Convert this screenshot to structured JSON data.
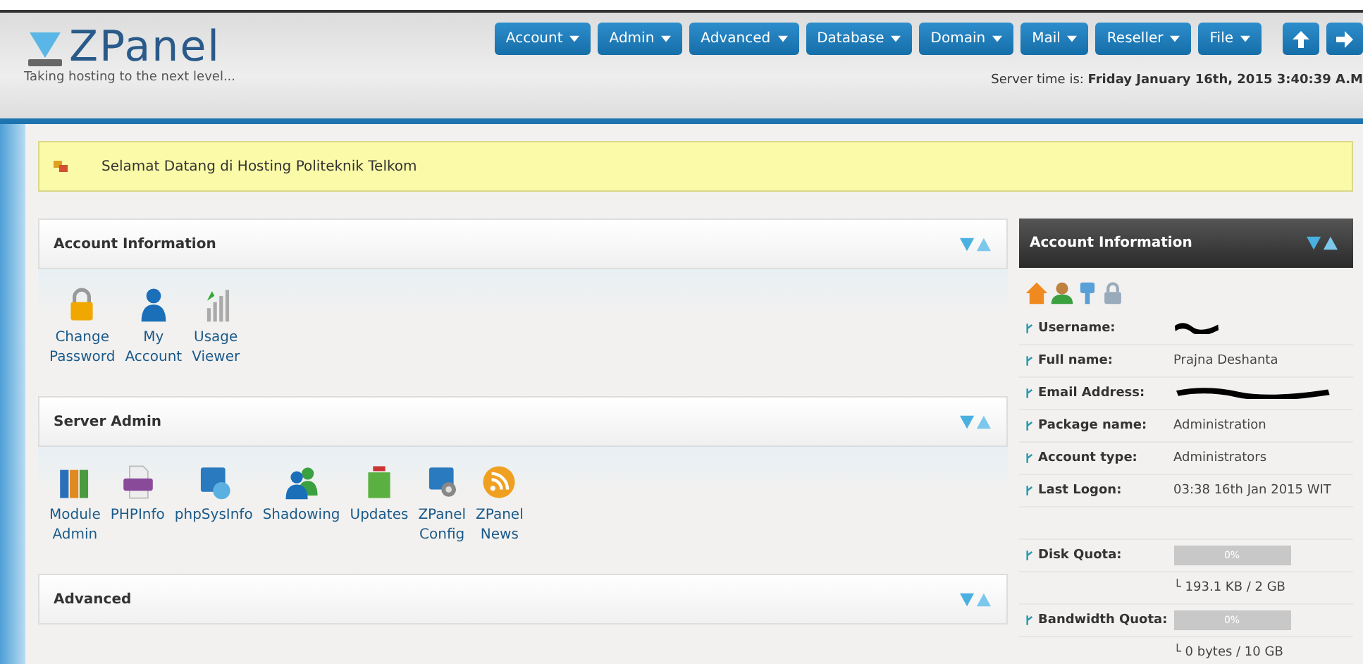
{
  "logo": {
    "name": "ZPanel",
    "tagline": "Taking hosting to the next level..."
  },
  "nav": [
    {
      "label": "Account",
      "kind": "menu"
    },
    {
      "label": "Admin",
      "kind": "menu"
    },
    {
      "label": "Advanced",
      "kind": "menu"
    },
    {
      "label": "Database",
      "kind": "menu"
    },
    {
      "label": "Domain",
      "kind": "menu"
    },
    {
      "label": "Mail",
      "kind": "menu"
    },
    {
      "label": "Reseller",
      "kind": "menu"
    },
    {
      "label": "File",
      "kind": "menu"
    },
    {
      "kind": "up"
    },
    {
      "kind": "logout"
    }
  ],
  "server_time": {
    "label": "Server time is:",
    "value": "Friday January 16th, 2015 3:40:39 A.M"
  },
  "notice": "Selamat Datang di Hosting Politeknik Telkom",
  "panels": [
    {
      "title": "Account Information",
      "modules": [
        {
          "label": "Change Password"
        },
        {
          "label": "My Account"
        },
        {
          "label": "Usage Viewer"
        }
      ]
    },
    {
      "title": "Server Admin",
      "modules": [
        {
          "label": "Module Admin"
        },
        {
          "label": "PHPInfo"
        },
        {
          "label": "phpSysInfo"
        },
        {
          "label": "Shadowing"
        },
        {
          "label": "Updates"
        },
        {
          "label": "ZPanel Config"
        },
        {
          "label": "ZPanel News"
        }
      ]
    },
    {
      "title": "Advanced"
    }
  ],
  "account_box": {
    "title": "Account Information",
    "rows": [
      {
        "kind": "redacted",
        "label": "Username:"
      },
      {
        "kind": "text",
        "label": "Full name:",
        "value": "Prajna Deshanta"
      },
      {
        "kind": "redacted",
        "label": "Email Address:"
      },
      {
        "kind": "text",
        "label": "Package name:",
        "value": "Administration"
      },
      {
        "kind": "text",
        "label": "Account type:",
        "value": "Administrators"
      },
      {
        "kind": "text",
        "label": "Last Logon:",
        "value": "03:38 16th Jan 2015 WIT"
      },
      {
        "kind": "blank"
      },
      {
        "kind": "quota",
        "label": "Disk Quota:",
        "level": 0,
        "reading": "0%"
      },
      {
        "kind": "note",
        "value": "└ 193.1 KB / 2 GB"
      },
      {
        "kind": "quota",
        "label": "Bandwidth Quota:",
        "level": 0,
        "reading": "0%"
      },
      {
        "kind": "note",
        "value": "└ 0 bytes / 10 GB"
      }
    ]
  }
}
